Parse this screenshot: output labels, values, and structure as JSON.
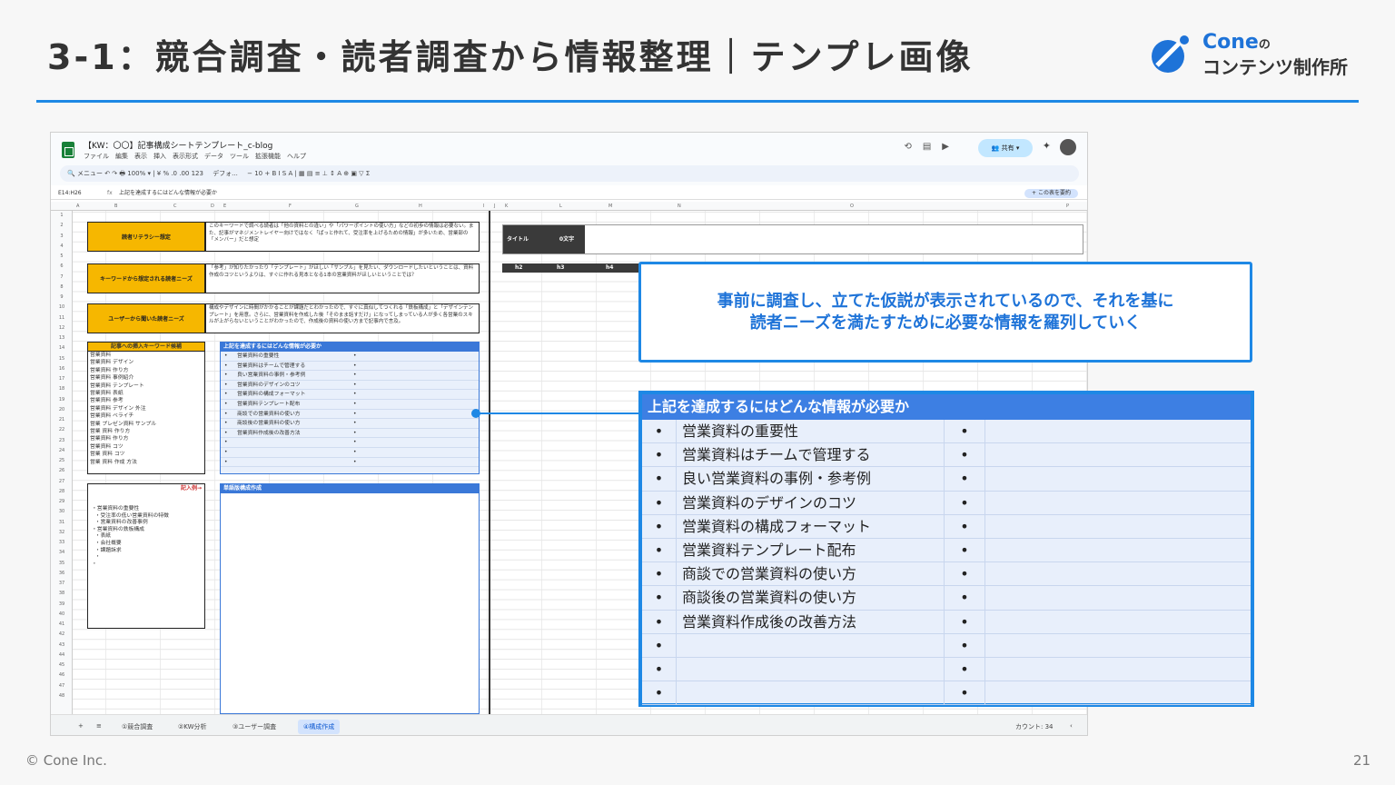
{
  "slide": {
    "title": "3-1：競合調査・読者調査から情報整理｜テンプレ画像",
    "footer": "© Cone Inc.",
    "page": "21",
    "accent_color": "#1e88e5"
  },
  "logo": {
    "name": "Cone",
    "particle": "の",
    "sub": "コンテンツ制作所"
  },
  "sheet": {
    "doc_title": "【KW：〇〇】記事構成シートテンプレート_c-blog",
    "menus": [
      "ファイル",
      "編集",
      "表示",
      "挿入",
      "表示形式",
      "データ",
      "ツール",
      "拡張機能",
      "ヘルプ"
    ],
    "share_label": "共有",
    "search_label": "メニュー",
    "zoom": "100%",
    "font_name": "デフォ...",
    "font_size": "10",
    "cell_ref": "E14:H26",
    "formula_text": "上記を達成するにはどんな情報が必要か",
    "summary_button": "この表を要約",
    "col_letters": [
      "A",
      "B",
      "C",
      "D",
      "E",
      "F",
      "G",
      "H",
      "I",
      "J",
      "K",
      "L",
      "M",
      "N",
      "O",
      "P"
    ],
    "reader": {
      "literacy_label": "読者リテラシー想定",
      "literacy_text": "このキーワードで調べる読者は「他の資料との違い」や「パワーポイントの使い方」などの初歩の情報は必要ない。また、記事がマネジメントレイヤー向けではなく「ぱっと作れて、受注率を上げるための情報」が多いため、営業部の「メンバー」だと想定",
      "needs_label": "キーワードから想定される読者ニーズ",
      "needs_text": "「参考」が知りたかったり「テンプレート」がほしい「サンプル」を見たい、ダウンロードしたいということは、資料作成のコツというよりは、すぐに作れる見本となる1本の営業資料がほしいということでは？",
      "user_label": "ユーザーから聞いた読者ニーズ",
      "user_text": "構成やデザインに時間がかかることが課題だとわかったので、すぐに真似してつくれる「鉄板構成」と「デザインテンプレート」を用意。さらに、営業資料を作成した後「そのまま話すだけ」になってしまっている人が多く各営業のスキルが上がらないということがわかったので、作成後の資料の使い方まで記事内で言及。"
    },
    "keywords": {
      "header": "記事への挿入キーワード候補",
      "items": [
        "営業資料",
        "営業資料 デザイン",
        "営業資料 作り方",
        "営業資料 事例紹介",
        "営業資料 テンプレート",
        "営業資料 表紙",
        "営業資料 参考",
        "営業資料 デザイン 外注",
        "営業資料 ベライチ",
        "営業 プレゼン資料 サンプル",
        "営業 資料 作り方",
        "営業資料 作り方",
        "営業資料 コツ",
        "営業 資料 コツ",
        "営業 資料 作成 方法"
      ]
    },
    "info": {
      "header": "上記を達成するにはどんな情報が必要か",
      "items": [
        "営業資料の重要性",
        "営業資料はチームで管理する",
        "良い営業資料の事例・参考例",
        "営業資料のデザインのコツ",
        "営業資料の構成フォーマット",
        "営業資料テンプレート配布",
        "商談での営業資料の使い方",
        "商談後の営業資料の使い方",
        "営業資料作成後の改善方法",
        "",
        "",
        ""
      ]
    },
    "example": {
      "header": "記入例→",
      "body": "・営業資料の重要性\n  ・受注率の低い営業資料の特徴\n  ・営業資料の改善事例\n・営業資料の鉄板構成\n  ・表紙\n  ・会社概要\n  ・課題訴求\n  ・\n・"
    },
    "draft_header": "単語版構成作成",
    "title_row": {
      "label": "タイトル",
      "count": "0文字"
    },
    "heading_cols": [
      "h2",
      "h3",
      "h4"
    ],
    "tabs": [
      "①競合調査",
      "②KW分析",
      "③ユーザー調査",
      "④構成作成"
    ],
    "count": "カウント: 34"
  },
  "callout": {
    "line1": "事前に調査し、立てた仮説が表示されているので、それを基に",
    "line2": "読者ニーズを満たすために必要な情報を羅列していく"
  },
  "zoom": {
    "header": "上記を達成するにはどんな情報が必要か",
    "bullet": "•",
    "rows": [
      "営業資料の重要性",
      "営業資料はチームで管理する",
      "良い営業資料の事例・参考例",
      "営業資料のデザインのコツ",
      "営業資料の構成フォーマット",
      "営業資料テンプレート配布",
      "商談での営業資料の使い方",
      "商談後の営業資料の使い方",
      "営業資料作成後の改善方法",
      "",
      "",
      ""
    ]
  }
}
